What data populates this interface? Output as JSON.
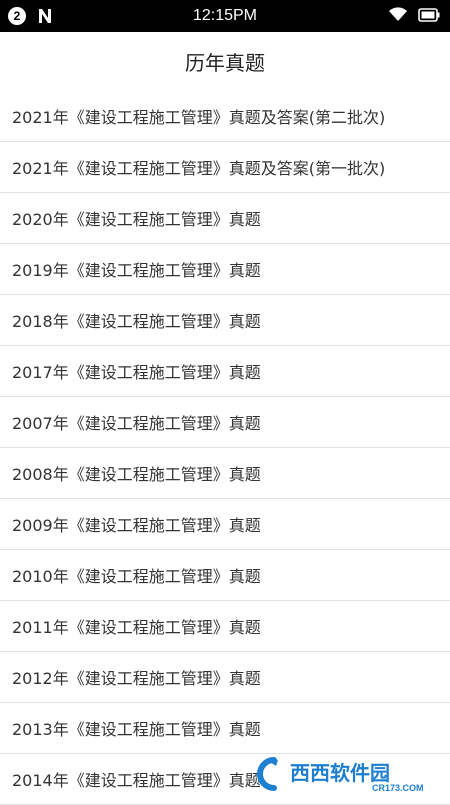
{
  "status_bar": {
    "notification_count": "2",
    "time": "12:15PM"
  },
  "header": {
    "title": "历年真题"
  },
  "exam_list": [
    "2021年《建设工程施工管理》真题及答案(第二批次)",
    "2021年《建设工程施工管理》真题及答案(第一批次)",
    "2020年《建设工程施工管理》真题",
    "2019年《建设工程施工管理》真题",
    "2018年《建设工程施工管理》真题",
    "2017年《建设工程施工管理》真题",
    "2007年《建设工程施工管理》真题",
    "2008年《建设工程施工管理》真题",
    "2009年《建设工程施工管理》真题",
    "2010年《建设工程施工管理》真题",
    "2011年《建设工程施工管理》真题",
    "2012年《建设工程施工管理》真题",
    "2013年《建设工程施工管理》真题",
    "2014年《建设工程施工管理》真题"
  ],
  "watermark": {
    "brand": "西西软件园",
    "url": "CR173.COM"
  },
  "colors": {
    "status_bar_bg": "#000000",
    "divider": "#e2e2e2",
    "text": "#333333"
  }
}
